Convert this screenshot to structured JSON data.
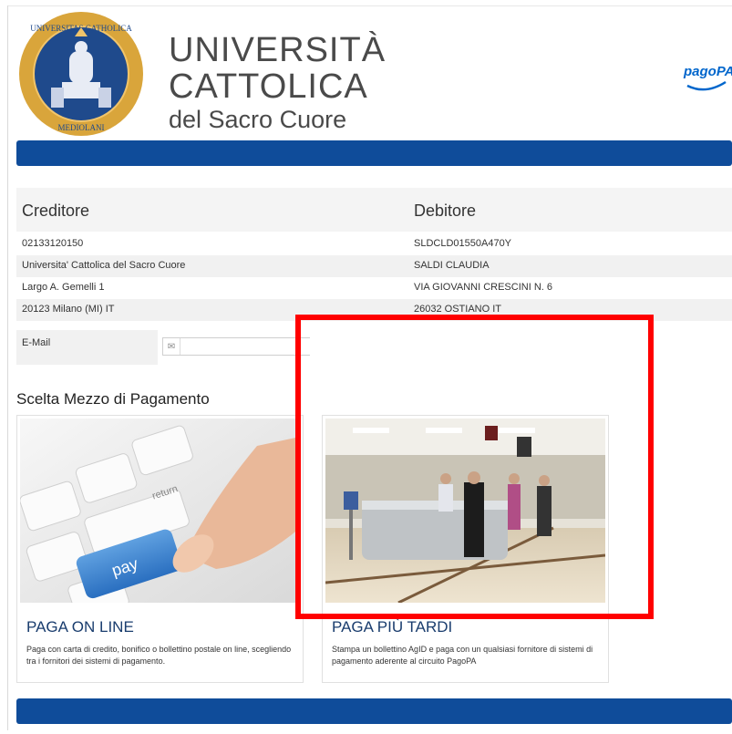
{
  "header": {
    "university_line1": "UNIVERSITÀ",
    "university_line2": "CATTOLICA",
    "university_line3": "del Sacro Cuore",
    "pagopa_logo": "pagoPA"
  },
  "creditor": {
    "heading": "Creditore",
    "lines": [
      "02133120150",
      "Universita' Cattolica del Sacro Cuore",
      "Largo A. Gemelli 1",
      "20123 Milano (MI) IT"
    ]
  },
  "debtor": {
    "heading": "Debitore",
    "lines": [
      "SLDCLD01550A470Y",
      "SALDI CLAUDIA",
      "VIA GIOVANNI CRESCINI N. 6",
      "26032 OSTIANO IT"
    ]
  },
  "email": {
    "label": "E-Mail",
    "value": "",
    "icon": "envelope-icon"
  },
  "payment": {
    "section_title": "Scelta Mezzo di Pagamento",
    "options": [
      {
        "title": "PAGA ON LINE",
        "description": "Paga con carta di credito, bonifico o bollettino postale on line, scegliendo tra i fornitori dei sistemi di pagamento.",
        "image": "keyboard-pay-key-photo",
        "key_label": "pay",
        "key_label_2": "return"
      },
      {
        "title": "PAGA PIÙ TARDI",
        "description": "Stampa un bollettino AgID e paga con un qualsiasi fornitore di sistemi di pagamento aderente al circuito PagoPA",
        "image": "bank-counter-photo"
      }
    ]
  },
  "colors": {
    "brand_blue": "#0f4c9a",
    "highlight": "#ff0000",
    "seal_gold": "#d9a53b"
  }
}
